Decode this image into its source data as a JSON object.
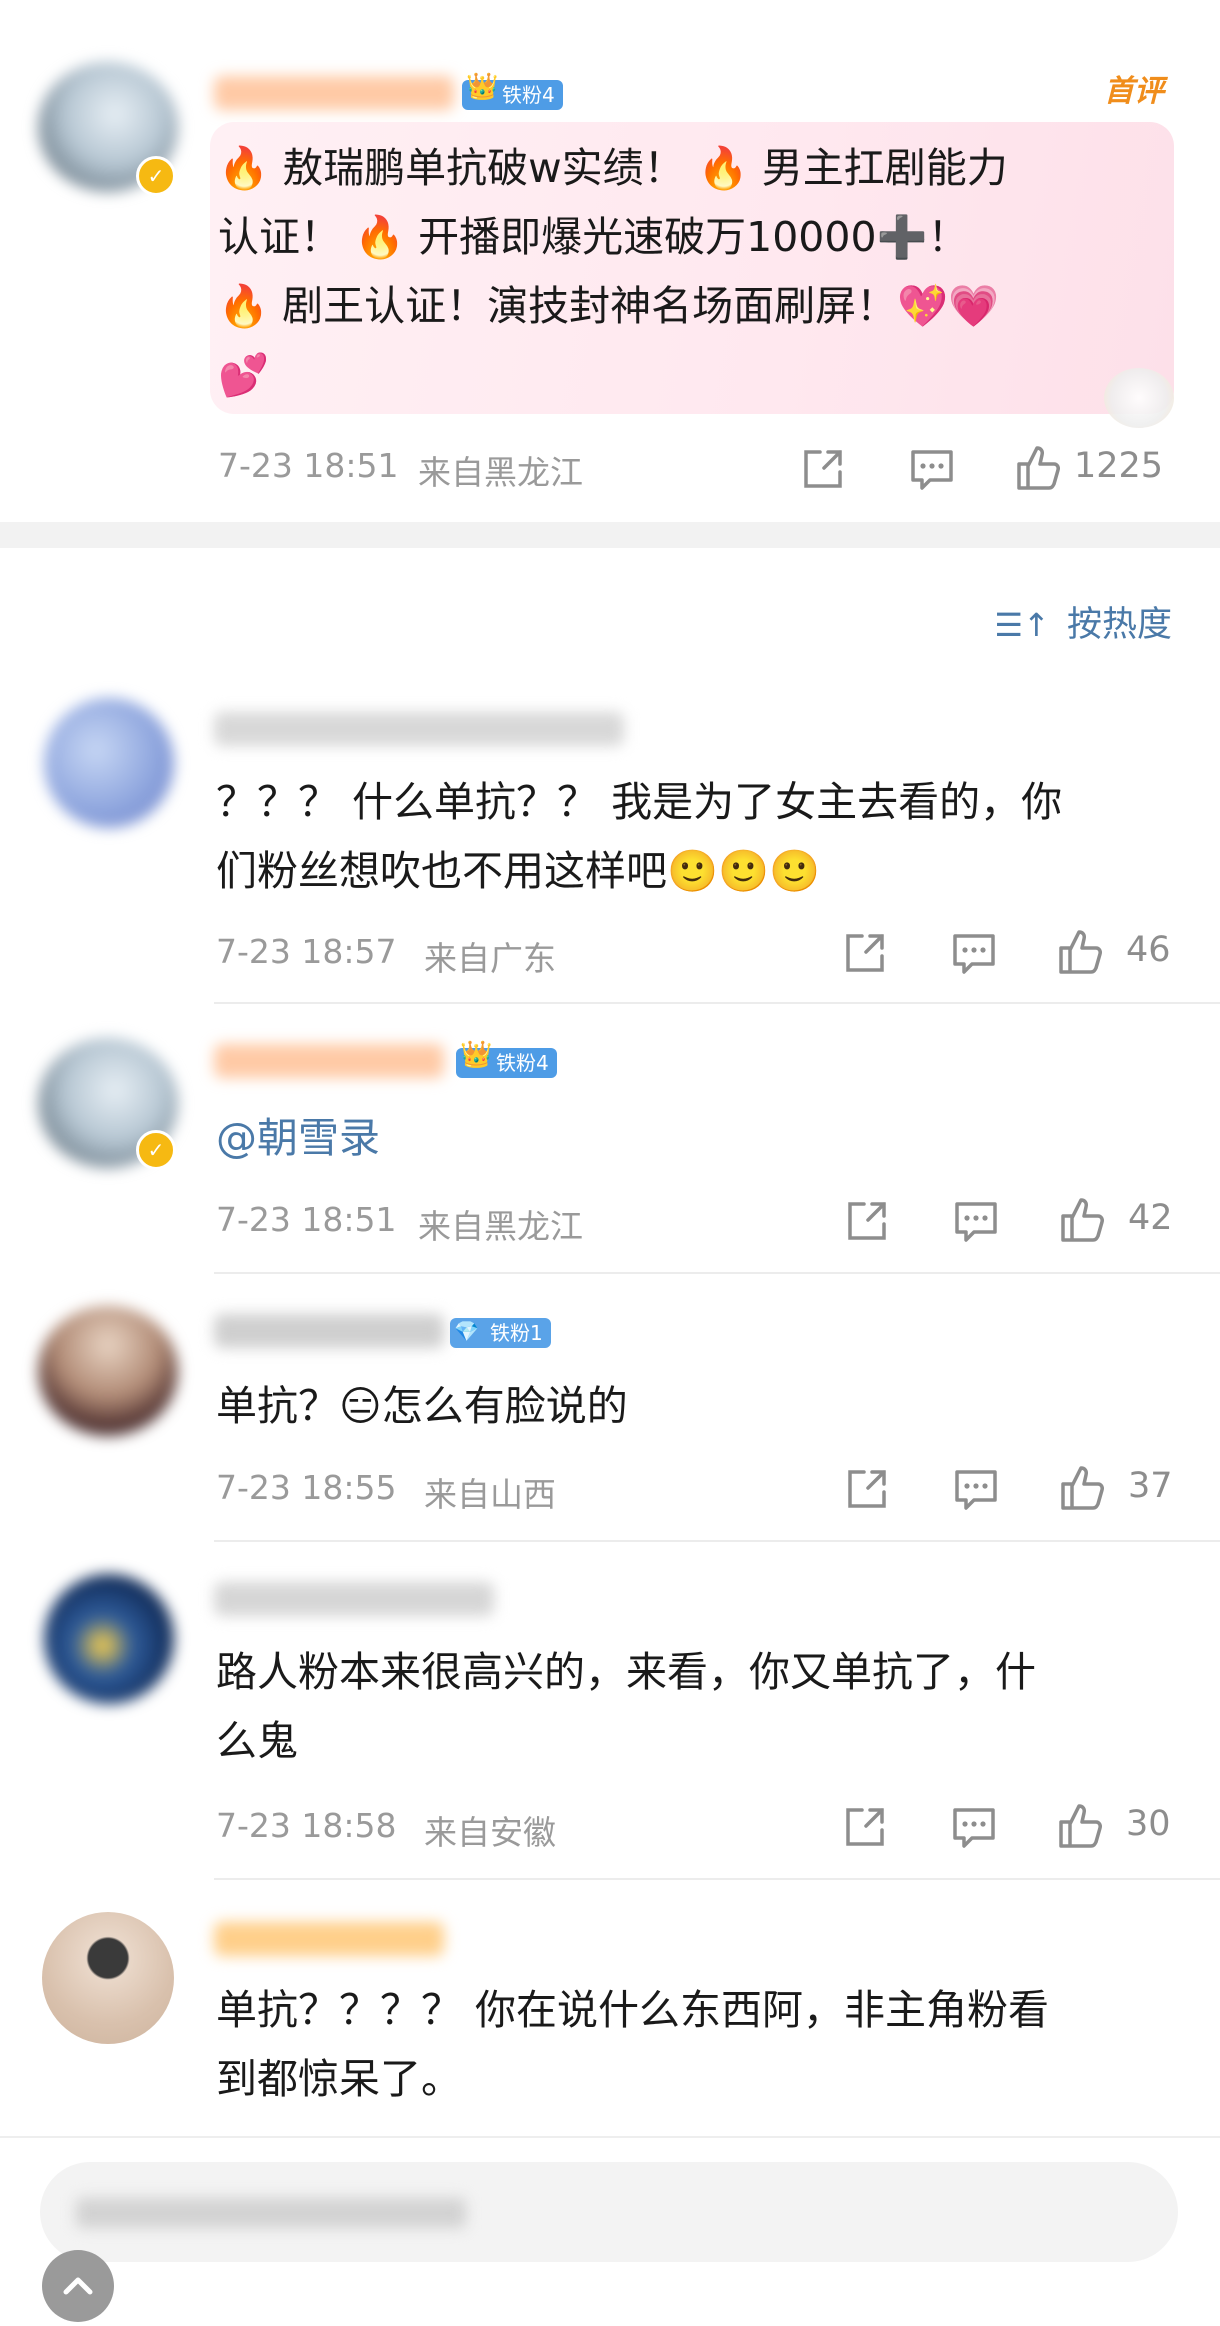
{
  "top_post": {
    "badge": "铁粉4",
    "first_comment_tag": "首评",
    "line1": "🔥 敖瑞鹏单抗破w实绩！ 🔥 男主扛剧能力",
    "line2": "认证！ 🔥 开播即爆光速破万10000➕！",
    "line3": "🔥 剧王认证！演技封神名场面刷屏！💖💗",
    "line4": "💕",
    "time": "7-23 18:51",
    "location": "来自黑龙江",
    "likes": "1225"
  },
  "sort": {
    "label": "按热度"
  },
  "comments": [
    {
      "line1": "？？？ 什么单抗？？ 我是为了女主去看的，你",
      "line2": "们粉丝想吹也不用这样吧🙂🙂🙂",
      "time": "7-23 18:57",
      "location": "来自广东",
      "likes": "46"
    },
    {
      "badge": "铁粉4",
      "line1": "@朝雪录",
      "time": "7-23 18:51",
      "location": "来自黑龙江",
      "likes": "42"
    },
    {
      "badge": "铁粉1",
      "line1": "单抗？😑怎么有脸说的",
      "time": "7-23 18:55",
      "location": "来自山西",
      "likes": "37"
    },
    {
      "line1": "路人粉本来很高兴的，来看，你又单抗了，什",
      "line2": "么鬼",
      "time": "7-23 18:58",
      "location": "来自安徽",
      "likes": "30"
    },
    {
      "line1": "单抗？？？？ 你在说什么东西阿，非主角粉看",
      "line2": "到都惊呆了。"
    }
  ],
  "colors": {
    "accent_blue": "#4a79a8",
    "fan_badge": "#4e9ce6",
    "first_comment": "#f08d1b"
  }
}
